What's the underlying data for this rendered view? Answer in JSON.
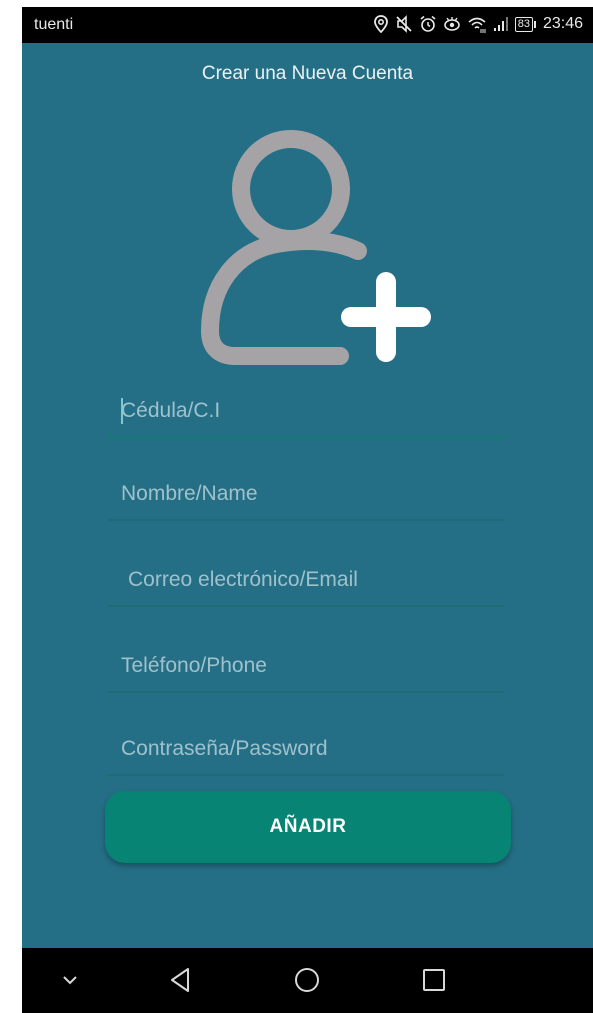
{
  "status_bar": {
    "carrier": "tuenti",
    "battery": "83",
    "time": "23:46",
    "icons": [
      "location-icon",
      "mute-icon",
      "alarm-icon",
      "eye-icon",
      "wifi-icon",
      "signal-icon",
      "battery-icon"
    ]
  },
  "screen": {
    "title": "Crear una Nueva Cuenta",
    "avatar_icon": "add-user-icon"
  },
  "form": {
    "cedula_placeholder": "Cédula/C.I",
    "name_placeholder": "Nombre/Name",
    "email_placeholder": "Correo electrónico/Email",
    "phone_placeholder": "Teléfono/Phone",
    "password_placeholder": "Contraseña/Password",
    "submit_label": "AÑADIR"
  },
  "nav_bar": {
    "buttons": [
      "chevron-down-icon",
      "back-icon",
      "home-icon",
      "recents-icon"
    ]
  },
  "colors": {
    "background": "#256f86",
    "button": "#078474",
    "avatar": "#a6a3a6",
    "plus": "#ffffff"
  }
}
